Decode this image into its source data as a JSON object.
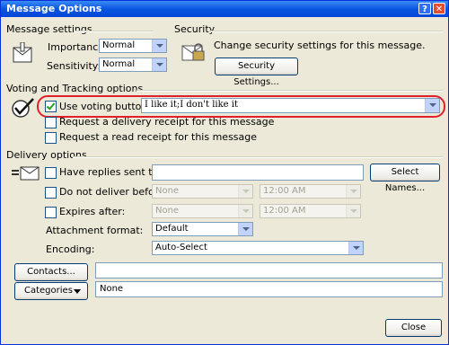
{
  "window": {
    "title": "Message Options"
  },
  "message_settings": {
    "heading": "Message settings",
    "importance_label": "Importance:",
    "importance_value": "Normal",
    "sensitivity_label": "Sensitivity:",
    "sensitivity_value": "Normal"
  },
  "security": {
    "heading": "Security",
    "description": "Change security settings for this message.",
    "button_label": "Security Settings..."
  },
  "voting": {
    "heading": "Voting and Tracking options",
    "use_voting_label": "Use voting buttons:",
    "use_voting_checked": true,
    "voting_value": "I like it;I don't like it",
    "delivery_receipt_label": "Request a delivery receipt for this message",
    "read_receipt_label": "Request a read receipt for this message"
  },
  "delivery": {
    "heading": "Delivery options",
    "replies_label": "Have replies sent to:",
    "replies_value": "",
    "select_names_label": "Select Names...",
    "do_not_deliver_label": "Do not deliver before:",
    "do_not_deliver_date": "None",
    "do_not_deliver_time": "12:00 AM",
    "expires_label": "Expires after:",
    "expires_date": "None",
    "expires_time": "12:00 AM",
    "attachment_label": "Attachment format:",
    "attachment_value": "Default",
    "encoding_label": "Encoding:",
    "encoding_value": "Auto-Select"
  },
  "contacts": {
    "button_label": "Contacts...",
    "value": ""
  },
  "categories": {
    "button_label": "Categories",
    "value": "None"
  },
  "footer": {
    "close_label": "Close"
  }
}
